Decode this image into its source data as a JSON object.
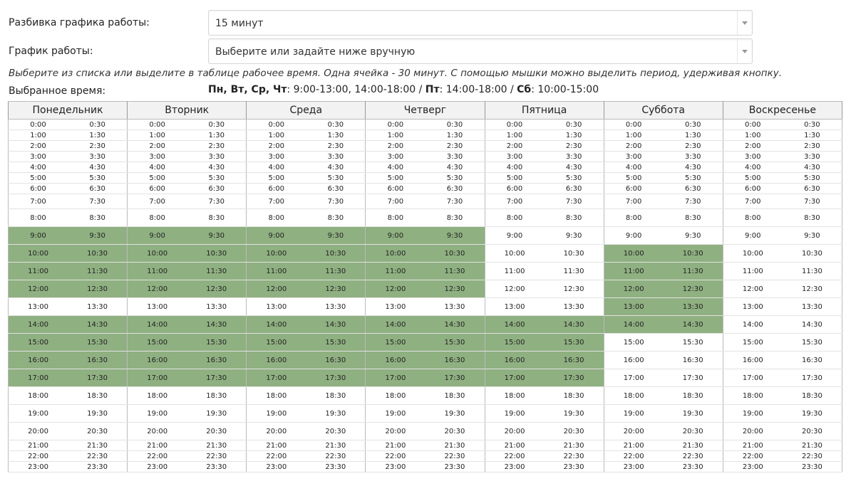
{
  "form": {
    "breakdown_label": "Разбивка графика работы:",
    "breakdown_value": "15 минут",
    "schedule_label": "График работы:",
    "schedule_value": "Выберите или задайте ниже вручную"
  },
  "hint": "Выберите из списка или выделите в таблице рабочее время. Одна ячейка - 30 минут. С помощью мышки можно выделить период, удерживая кнопку.",
  "selected": {
    "label": "Выбранное время:",
    "days1": "Пн, Вт, Ср, Чт",
    "time1": ": 9:00-13:00, 14:00-18:00 / ",
    "days2": "Пт",
    "time2": ": 14:00-18:00 / ",
    "days3": "Сб",
    "time3": ": 10:00-15:00"
  },
  "days": [
    "Понедельник",
    "Вторник",
    "Среда",
    "Четверг",
    "Пятница",
    "Суббота",
    "Воскресенье"
  ],
  "hours": [
    "0:00",
    "1:00",
    "2:00",
    "3:00",
    "4:00",
    "5:00",
    "6:00",
    "7:00",
    "8:00",
    "9:00",
    "10:00",
    "11:00",
    "12:00",
    "13:00",
    "14:00",
    "15:00",
    "16:00",
    "17:00",
    "18:00",
    "19:00",
    "20:00",
    "21:00",
    "22:00",
    "23:00"
  ],
  "half_hours": [
    "0:30",
    "1:30",
    "2:30",
    "3:30",
    "4:30",
    "5:30",
    "6:30",
    "7:30",
    "8:30",
    "9:30",
    "10:30",
    "11:30",
    "12:30",
    "13:30",
    "14:30",
    "15:30",
    "16:30",
    "17:30",
    "18:30",
    "19:30",
    "20:30",
    "21:30",
    "22:30",
    "23:30"
  ],
  "selected_hours": [
    [
      9,
      10,
      11,
      12,
      14,
      15,
      16,
      17
    ],
    [
      9,
      10,
      11,
      12,
      14,
      15,
      16,
      17
    ],
    [
      9,
      10,
      11,
      12,
      14,
      15,
      16,
      17
    ],
    [
      9,
      10,
      11,
      12,
      14,
      15,
      16,
      17
    ],
    [
      14,
      15,
      16,
      17
    ],
    [
      10,
      11,
      12,
      13,
      14
    ],
    []
  ],
  "colors": {
    "selected": "#8fb081"
  }
}
